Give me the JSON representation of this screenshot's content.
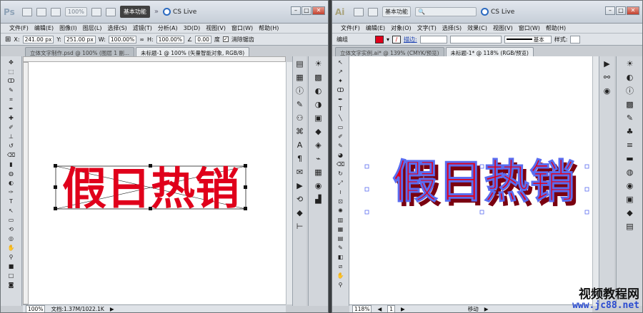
{
  "ps": {
    "logo": "Ps",
    "zoom_field": "100%",
    "workspace": "基本功能",
    "cslive": "CS Live",
    "menu": [
      "文件(F)",
      "编辑(E)",
      "图像(I)",
      "图层(L)",
      "选择(S)",
      "滤镜(T)",
      "分析(A)",
      "3D(D)",
      "视图(V)",
      "窗口(W)",
      "帮助(H)"
    ],
    "options": {
      "x_label": "X:",
      "x": "241.00 px",
      "y_label": "Y:",
      "y": "251.00 px",
      "w_label": "W:",
      "w": "100.00%",
      "h_label": "H:",
      "h": "100.00%",
      "angle": "0.00",
      "angle_unit": "度",
      "aa_label": "消除锯齿"
    },
    "tabs": [
      "立体文字制作.psd @ 100% (图层 1 副...",
      "未标题-1 @ 100% (矢量智能对象, RGB/8)"
    ],
    "artwork_text": "假日热销",
    "status": {
      "zoom": "100%",
      "doc": "文档:1.37M/1022.1K"
    }
  },
  "ai": {
    "logo": "Ai",
    "workspace": "基本功能",
    "cslive": "CS Live",
    "menu": [
      "文件(F)",
      "编辑(E)",
      "对象(O)",
      "文字(T)",
      "选择(S)",
      "效果(C)",
      "视图(V)",
      "窗口(W)",
      "帮助(H)"
    ],
    "options": {
      "group": "编组",
      "stroke_label": "描边:",
      "style_label": "基本",
      "style2_label": "样式:"
    },
    "tabs": [
      "立体文字实例.ai* @ 139% (CMYK/预览)",
      "未标题-1* @ 118% (RGB/预览)"
    ],
    "artwork_text": "假日热销",
    "status": {
      "zoom": "118%",
      "page": "1",
      "mode": "移动"
    }
  },
  "watermark": {
    "line1": "视频教程网",
    "line2": "www.jc88.net"
  },
  "colors": {
    "accent_red": "#e0001b",
    "dark_red": "#7a0010",
    "selection_blue": "#5a6cf0"
  }
}
